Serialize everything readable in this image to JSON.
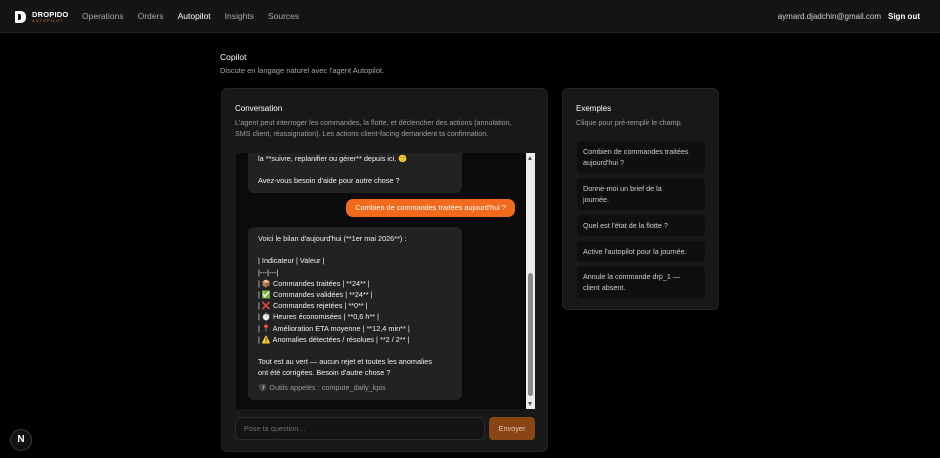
{
  "brand": {
    "name": "DROPIDO",
    "tagline": "AUTOPILOT"
  },
  "nav": {
    "items": [
      {
        "label": "Operations"
      },
      {
        "label": "Orders"
      },
      {
        "label": "Autopilot"
      },
      {
        "label": "Insights"
      },
      {
        "label": "Sources"
      }
    ],
    "active": "Autopilot"
  },
  "user": {
    "email": "aymard.djadchin@gmail.com",
    "signout_label": "Sign out"
  },
  "page": {
    "title": "Copilot",
    "subtitle": "Discute en langage naturel avec l'agent Autopilot."
  },
  "conversation": {
    "title": "Conversation",
    "description_lines": [
      "L'agent peut interroger les commandes, la flotte, et déclencher des actions (annulation,",
      "SMS client, réassignation). Les actions client-facing demandent ta confirmation."
    ],
    "messages": [
      {
        "role": "assistant",
        "lines": [
          "la **suivre, replanifier ou gérer** depuis ici. 🙂",
          "",
          "Avez-vous besoin d'aide pour autre chose ?"
        ]
      },
      {
        "role": "user",
        "text": "Combien de commandes traitées aujourd'hui ?"
      },
      {
        "role": "assistant",
        "lines": [
          "Voici le bilan d'aujourd'hui (**1er mai 2026**) :",
          "",
          "| Indicateur | Valeur |",
          "|---|---|",
          "| 📦 Commandes traitées | **24** |",
          "| ✅ Commandes validées | **24** |",
          "| ❌ Commandes rejetées | **0** |",
          "| ⏱️ Heures économisées | **0,6 h** |",
          "| 📍 Amélioration ETA moyenne | **12,4 min** |",
          "| ⚠️ Anomalies détectées / résolues | **2 / 2** |",
          "",
          "Tout est au vert — aucun rejet et toutes les anomalies",
          "ont été corrigées. Besoin d'autre chose ?"
        ],
        "tools": "🛡 Outils appelés : compute_daily_kpis"
      }
    ],
    "input_placeholder": "Pose ta question…",
    "input_value": "",
    "send_label": "Envoyer"
  },
  "examples": {
    "title": "Exemples",
    "description": "Clique pour pré-remplir le champ.",
    "items": [
      {
        "lines": [
          "Combien de commandes traitées",
          "aujourd'hui ?"
        ]
      },
      {
        "lines": [
          "Donne-moi un brief de la",
          "journée."
        ]
      },
      {
        "lines": [
          "Quel est l'état de la flotte ?"
        ]
      },
      {
        "lines": [
          "Active l'autopilot pour la journée."
        ]
      },
      {
        "lines": [
          "Annule la commande drp_1 —",
          "client absent."
        ]
      }
    ]
  },
  "dev_badge": {
    "label": "N"
  },
  "colors": {
    "accent": "#f26a1b",
    "send_button": "#8a4514",
    "panel": "#181818",
    "background": "#000000"
  }
}
